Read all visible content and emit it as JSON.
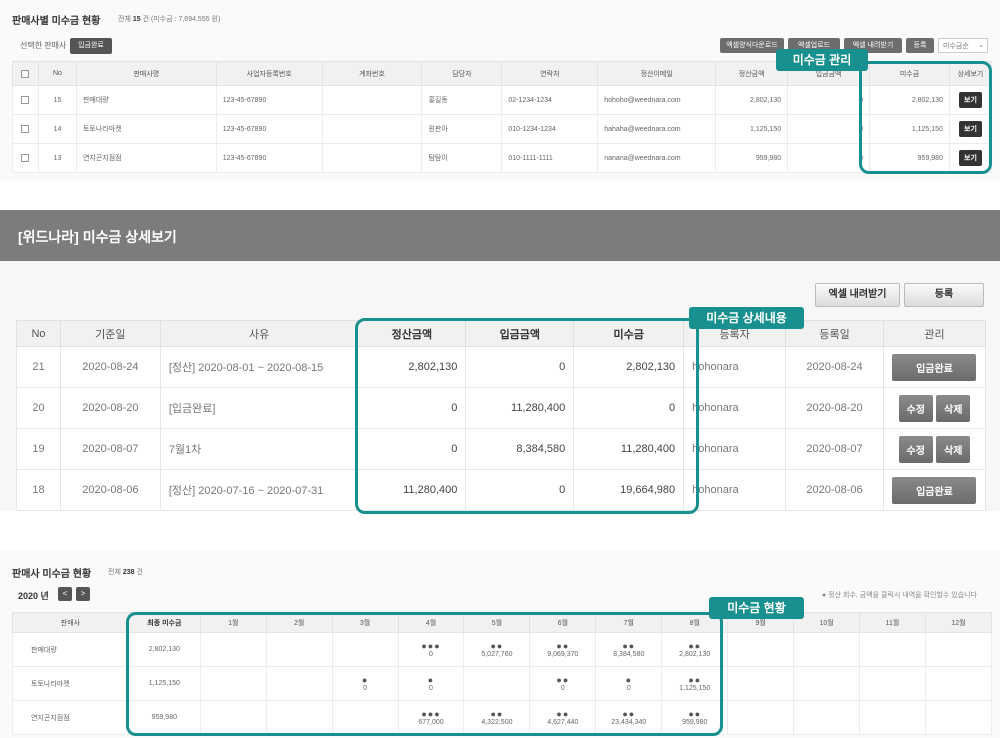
{
  "sec1": {
    "title": "판매사별 미수금 현황",
    "count_prefix": "전체",
    "count": "15",
    "count_suffix": "건 (미수금 : 7,694,555 원)",
    "selected_label": "선택한 판매사",
    "complete_btn": "입금완료",
    "btn_sample_download": "엑셀양식다운로드",
    "btn_excel_upload": "엑셀업로드",
    "btn_excel_download": "엑셀 내려받기",
    "btn_register": "등록",
    "sort_value": "미수금순",
    "headers": [
      "No",
      "판매사명",
      "사업자등록번호",
      "계좌번호",
      "담당자",
      "연락처",
      "정산이메일",
      "정산금액",
      "입금금액",
      "미수금",
      "상세보기"
    ],
    "rows": [
      {
        "no": "15",
        "name": "판매대량",
        "biz": "123-45-67890",
        "account": "",
        "manager": "홍길동",
        "phone": "02-1234-1234",
        "email": "hohoho@weednara.com",
        "settle": "2,802,130",
        "paid": "0",
        "unpaid": "2,802,130",
        "view": "보기"
      },
      {
        "no": "14",
        "name": "토토나라마켓",
        "biz": "123-45-67890",
        "account": "",
        "manager": "원판아",
        "phone": "010-1234-1234",
        "email": "hahaha@weednara.com",
        "settle": "1,125,150",
        "paid": "0",
        "unpaid": "1,125,150",
        "view": "보기"
      },
      {
        "no": "13",
        "name": "연지곤지점점",
        "biz": "123-45-67890",
        "account": "",
        "manager": "탐탐이",
        "phone": "010-1111-1111",
        "email": "nanana@weednara.com",
        "settle": "959,980",
        "paid": "0",
        "unpaid": "959,980",
        "view": "보기"
      }
    ],
    "tag": "미수금 관리"
  },
  "sec2": {
    "title": "[위드나라] 미수금 상세보기",
    "btn_excel": "엑셀 내려받기",
    "btn_register": "등록",
    "headers": [
      "No",
      "기준일",
      "사유",
      "정산금액",
      "입금금액",
      "미수금",
      "등록자",
      "등록일",
      "관리"
    ],
    "rows": [
      {
        "no": "21",
        "date": "2020-08-24",
        "reason": "[정산] 2020-08-01 ~ 2020-08-15",
        "settle": "2,802,130",
        "paid": "0",
        "unpaid": "2,802,130",
        "user": "hohonara",
        "reg": "2020-08-24",
        "btn1": "입금완료"
      },
      {
        "no": "20",
        "date": "2020-08-20",
        "reason": "[입금완료]",
        "settle": "0",
        "paid": "11,280,400",
        "unpaid": "0",
        "user": "hohonara",
        "reg": "2020-08-20",
        "btn1": "수정",
        "btn2": "삭제"
      },
      {
        "no": "19",
        "date": "2020-08-07",
        "reason": "7월1차",
        "settle": "0",
        "paid": "8,384,580",
        "unpaid": "11,280,400",
        "user": "hohonara",
        "reg": "2020-08-07",
        "btn1": "수정",
        "btn2": "삭제"
      },
      {
        "no": "18",
        "date": "2020-08-06",
        "reason": "[정산] 2020-07-16 ~ 2020-07-31",
        "settle": "11,280,400",
        "paid": "0",
        "unpaid": "19,664,980",
        "user": "hohonara",
        "reg": "2020-08-06",
        "btn1": "입금완료"
      }
    ],
    "tag": "미수금 상세내용"
  },
  "sec3": {
    "title": "판매사 미수금 현황",
    "count_prefix": "전체",
    "count": "238",
    "count_suffix": "건",
    "year": "2020 년",
    "prev": "<",
    "next": ">",
    "note": "● 정산 회수, 금액을 클릭시 내역을 확인할수 있습니다",
    "headers": [
      "판매사",
      "최종 미수금",
      "1월",
      "2월",
      "3월",
      "4월",
      "5월",
      "6월",
      "7월",
      "8월",
      "9월",
      "10월",
      "11월",
      "12월"
    ],
    "rows": [
      {
        "name": "판매대량",
        "final": "2,802,130",
        "months": [
          {
            "d": "",
            "a": ""
          },
          {
            "d": "",
            "a": ""
          },
          {
            "d": "",
            "a": ""
          },
          {
            "d": "●●●",
            "a": "0"
          },
          {
            "d": "●●",
            "a": "5,027,760"
          },
          {
            "d": "●●",
            "a": "9,069,370"
          },
          {
            "d": "●●",
            "a": "8,384,580"
          },
          {
            "d": "●●",
            "a": "2,802,130"
          },
          {
            "d": "",
            "a": ""
          },
          {
            "d": "",
            "a": ""
          },
          {
            "d": "",
            "a": ""
          },
          {
            "d": "",
            "a": ""
          }
        ]
      },
      {
        "name": "토토나라마켓",
        "final": "1,125,150",
        "months": [
          {
            "d": "",
            "a": ""
          },
          {
            "d": "",
            "a": ""
          },
          {
            "d": "●",
            "a": "0"
          },
          {
            "d": "●",
            "a": "0"
          },
          {
            "d": "",
            "a": ""
          },
          {
            "d": "●●",
            "a": "0"
          },
          {
            "d": "●",
            "a": "0"
          },
          {
            "d": "●●",
            "a": "1,125,150"
          },
          {
            "d": "",
            "a": ""
          },
          {
            "d": "",
            "a": ""
          },
          {
            "d": "",
            "a": ""
          },
          {
            "d": "",
            "a": ""
          }
        ]
      },
      {
        "name": "연지곤지점점",
        "final": "959,980",
        "months": [
          {
            "d": "",
            "a": ""
          },
          {
            "d": "",
            "a": ""
          },
          {
            "d": "",
            "a": ""
          },
          {
            "d": "●●●",
            "a": "677,000"
          },
          {
            "d": "●●",
            "a": "4,322,500"
          },
          {
            "d": "●●",
            "a": "4,627,440"
          },
          {
            "d": "●●",
            "a": "23,434,340"
          },
          {
            "d": "●●",
            "a": "959,980"
          },
          {
            "d": "",
            "a": ""
          },
          {
            "d": "",
            "a": ""
          },
          {
            "d": "",
            "a": ""
          },
          {
            "d": "",
            "a": ""
          }
        ]
      }
    ],
    "tag": "미수금 현황"
  }
}
